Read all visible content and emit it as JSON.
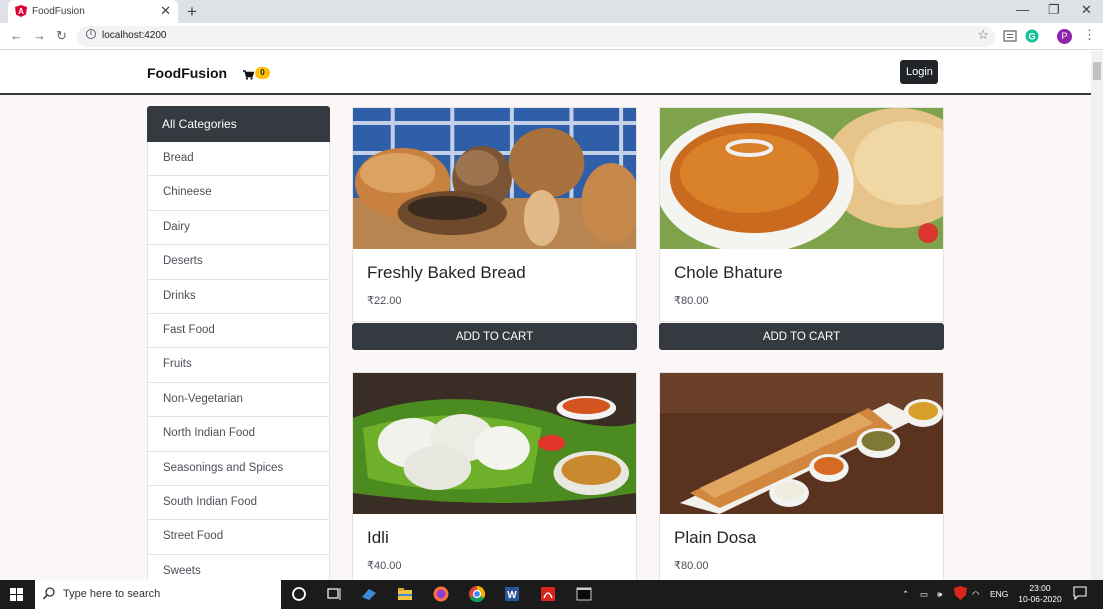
{
  "browser": {
    "tab_title": "FoodFusion",
    "url": "localhost:4200",
    "profile_initial": "P"
  },
  "navbar": {
    "brand": "FoodFusion",
    "cart_count": "0",
    "login_label": "Login"
  },
  "sidebar": {
    "header": "All Categories",
    "items": [
      {
        "label": "Bread"
      },
      {
        "label": "Chineese"
      },
      {
        "label": "Dairy"
      },
      {
        "label": "Deserts"
      },
      {
        "label": "Drinks"
      },
      {
        "label": "Fast Food"
      },
      {
        "label": "Fruits"
      },
      {
        "label": "Non-Vegetarian"
      },
      {
        "label": "North Indian Food"
      },
      {
        "label": "Seasonings and Spices"
      },
      {
        "label": "South Indian Food"
      },
      {
        "label": "Street Food"
      },
      {
        "label": "Sweets"
      }
    ]
  },
  "products": [
    {
      "name": "Freshly Baked Bread",
      "price": "₹22.00",
      "button": "ADD TO CART"
    },
    {
      "name": "Chole Bhature",
      "price": "₹80.00",
      "button": "ADD TO CART"
    },
    {
      "name": "Idli",
      "price": "₹40.00"
    },
    {
      "name": "Plain Dosa",
      "price": "₹80.00"
    }
  ],
  "taskbar": {
    "search_placeholder": "Type here to search",
    "language": "ENG",
    "time": "23:00",
    "date": "10-06-2020"
  },
  "colors": {
    "dark": "#343a40",
    "badge": "#ffc107",
    "page_bg": "#fbf7f7"
  }
}
